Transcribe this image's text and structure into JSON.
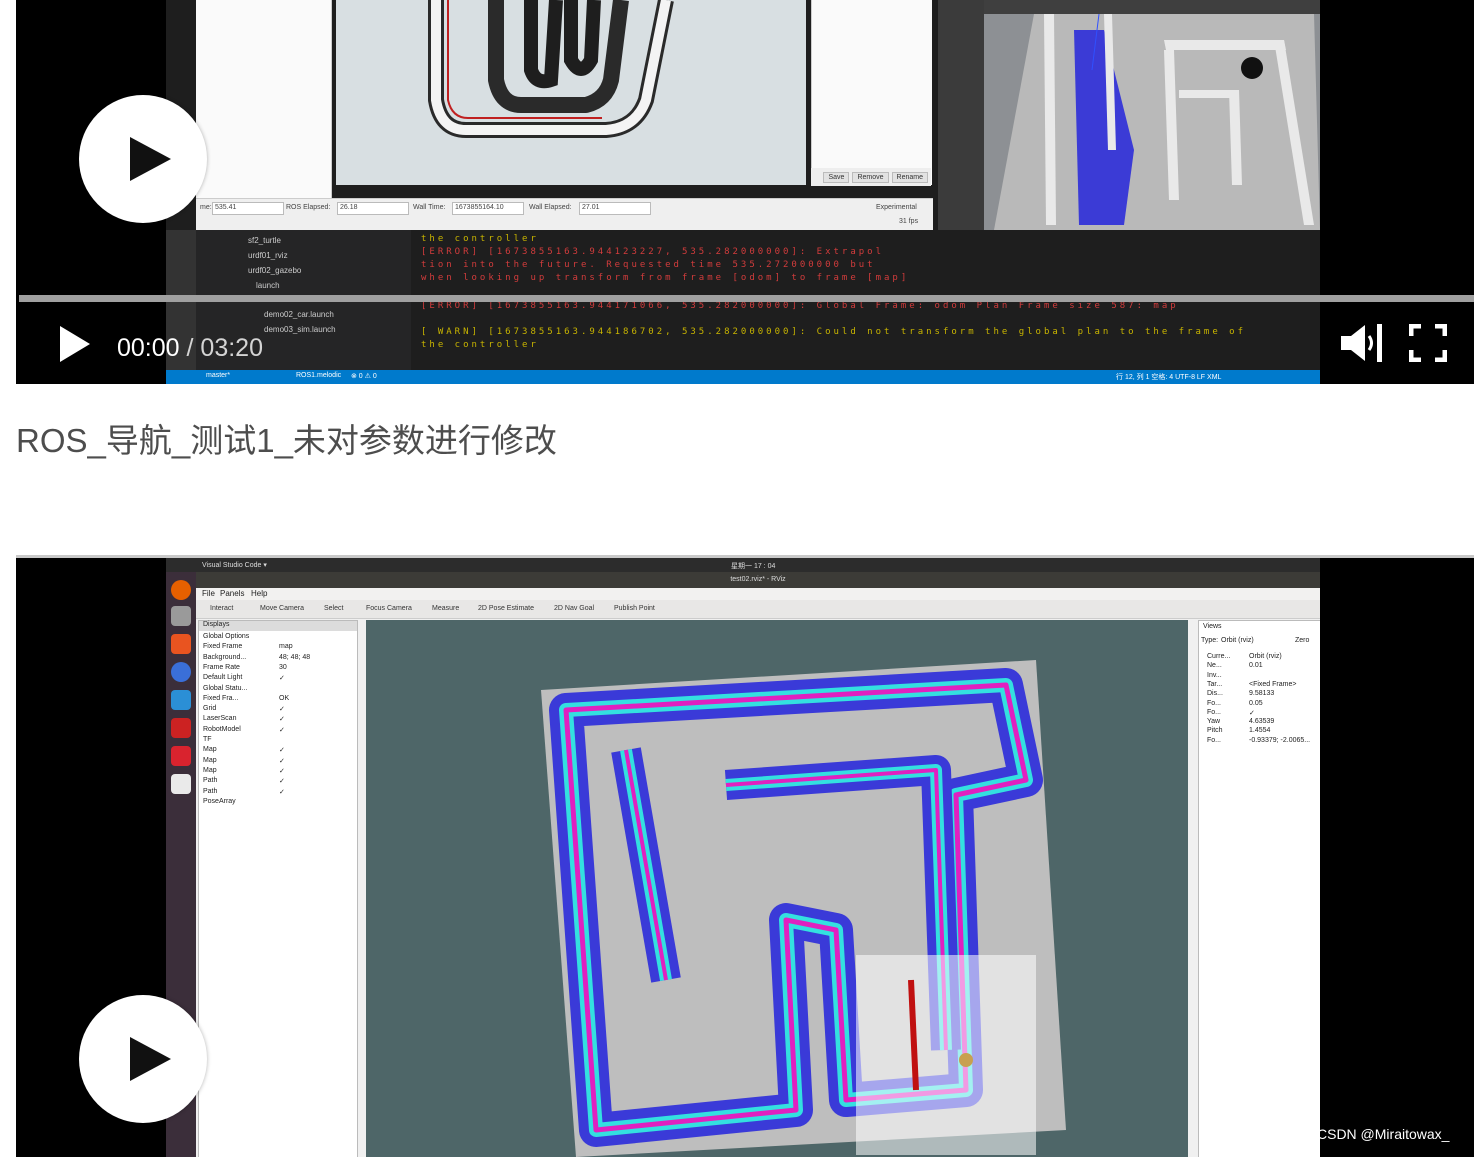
{
  "video1": {
    "current_time": "00:00",
    "separator": "/",
    "duration": "03:20",
    "controls": {
      "play": "play-icon",
      "volume": "volume-icon",
      "fullscreen": "fullscreen-icon"
    },
    "rviz_timebar": {
      "ros_time": "535.41",
      "ros_elapsed_label": "ROS Elapsed:",
      "ros_elapsed": "26.18",
      "wall_time_label": "Wall Time:",
      "wall_time": "1673855164.10",
      "wall_elapsed_label": "Wall Elapsed:",
      "wall_elapsed": "27.01",
      "experimental": "Experimental",
      "fps": "31 fps"
    },
    "rviz_buttons": [
      "Save",
      "Remove",
      "Rename"
    ],
    "explorer_items": [
      "sf2_turtle",
      "urdf01_rviz",
      "urdf02_gazebo",
      "launch",
      "demo02_car.launch",
      "demo03_sim.launch"
    ],
    "terminal_lines": [
      {
        "text": "the controller",
        "color": "#c8b400"
      },
      {
        "text": "[ERROR] [1673855163.944123227, 535.282000000]: Extrapol",
        "color": "#d23c3c"
      },
      {
        "text": "tion into the future.  Requested time 535.272000000 but",
        "color": "#d23c3c"
      },
      {
        "text": "when looking up transform from frame [odom] to frame [map]",
        "color": "#d23c3c"
      },
      {
        "text": "[ERROR] [1673855163.944171066, 535.282000000]: Global Frame: odom Plan Frame size 587: map",
        "color": "#d23c3c"
      },
      {
        "text": "[ WARN] [1673855163.944186702, 535.282000000]: Could not transform the global plan to the frame of",
        "color": "#c8b400"
      },
      {
        "text": "the controller",
        "color": "#c8b400"
      }
    ],
    "status_left": "master*",
    "status_env": "ROS1.melodic",
    "status_counts": "⊗ 0 ⚠ 0",
    "status_right": "行 12, 列 1   空格: 4   UTF-8   LF   XML"
  },
  "video1_title": "ROS_导航_测试1_未对参数进行修改",
  "video2": {
    "topbar_left": "Visual Studio Code ▾",
    "topbar_center": "星期一 17 : 04",
    "window_title": "test02.rviz* - RViz",
    "menu": [
      "File",
      "Panels",
      "Help"
    ],
    "tools": [
      "Interact",
      "Move Camera",
      "Select",
      "Focus Camera",
      "Measure",
      "2D Pose Estimate",
      "2D Nav Goal",
      "Publish Point"
    ],
    "displays_title": "Displays",
    "displays": [
      {
        "name": "Global Options",
        "value": ""
      },
      {
        "name": "Fixed Frame",
        "value": "map"
      },
      {
        "name": "Background...",
        "value": "48; 48; 48"
      },
      {
        "name": "Frame Rate",
        "value": "30"
      },
      {
        "name": "Default Light",
        "value": "✓"
      },
      {
        "name": "Global Statu...",
        "value": ""
      },
      {
        "name": "Fixed Fra...",
        "value": "OK"
      },
      {
        "name": "Grid",
        "value": "✓"
      },
      {
        "name": "LaserScan",
        "value": "✓"
      },
      {
        "name": "RobotModel",
        "value": "✓"
      },
      {
        "name": "TF",
        "value": ""
      },
      {
        "name": "Map",
        "value": "✓"
      },
      {
        "name": "Map",
        "value": "✓"
      },
      {
        "name": "Map",
        "value": "✓"
      },
      {
        "name": "Path",
        "value": "✓"
      },
      {
        "name": "Path",
        "value": "✓"
      },
      {
        "name": "PoseArray",
        "value": ""
      }
    ],
    "views_title": "Views",
    "views_type_label": "Type:",
    "views_type": "Orbit (rviz)",
    "views_zero": "Zero",
    "views": [
      {
        "name": "Curre...",
        "value": "Orbit (rviz)"
      },
      {
        "name": "Ne...",
        "value": "0.01"
      },
      {
        "name": "Inv...",
        "value": ""
      },
      {
        "name": "Tar...",
        "value": "<Fixed Frame>"
      },
      {
        "name": "Dis...",
        "value": "9.58133"
      },
      {
        "name": "Fo...",
        "value": "0.05"
      },
      {
        "name": "Fo...",
        "value": "✓"
      },
      {
        "name": "Yaw",
        "value": "4.63539"
      },
      {
        "name": "Pitch",
        "value": "1.4554"
      },
      {
        "name": "Fo...",
        "value": "-0.93379; -2.0065..."
      }
    ]
  },
  "watermark": "CSDN @Miraitowax_",
  "colors": {
    "accent_blue": "#007acc",
    "costmap_blue": "#3a3ad8",
    "costmap_cyan": "#33e0e0",
    "costmap_magenta": "#e020c0",
    "title_text": "#4d4d4d"
  }
}
